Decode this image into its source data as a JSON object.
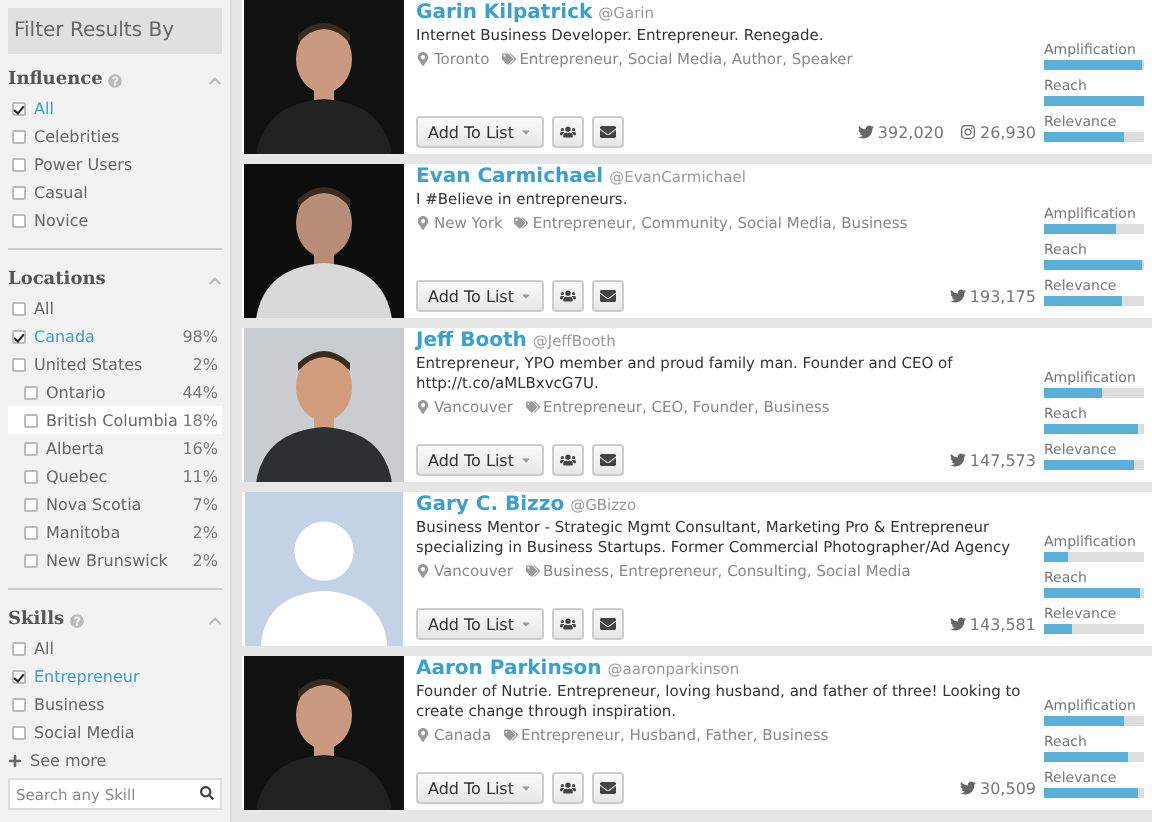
{
  "sidebar": {
    "title": "Filter Results By",
    "sections": [
      {
        "title": "Influence",
        "info_icon": true,
        "items": [
          {
            "label": "All",
            "checked": true,
            "highlighted": false
          },
          {
            "label": "Celebrities",
            "checked": false,
            "highlighted": false
          },
          {
            "label": "Power Users",
            "checked": false,
            "highlighted": false
          },
          {
            "label": "Casual",
            "checked": false,
            "highlighted": false
          },
          {
            "label": "Novice",
            "checked": false,
            "highlighted": false
          }
        ]
      },
      {
        "title": "Locations",
        "info_icon": false,
        "items": [
          {
            "label": "All",
            "checked": false,
            "highlighted": false
          },
          {
            "label": "Canada",
            "share": "98%",
            "checked": true,
            "highlighted": false
          },
          {
            "label": "United States",
            "share": "2%",
            "checked": false,
            "highlighted": false,
            "children": [
              {
                "label": "Ontario",
                "share": "44%",
                "checked": false,
                "highlighted": false
              },
              {
                "label": "British Columbia",
                "share": "18%",
                "checked": false,
                "highlighted": true
              },
              {
                "label": "Alberta",
                "share": "16%",
                "checked": false,
                "highlighted": false
              },
              {
                "label": "Quebec",
                "share": "11%",
                "checked": false,
                "highlighted": false
              },
              {
                "label": "Nova Scotia",
                "share": "7%",
                "checked": false,
                "highlighted": false
              },
              {
                "label": "Manitoba",
                "share": "2%",
                "checked": false,
                "highlighted": false
              },
              {
                "label": "New Brunswick",
                "share": "2%",
                "checked": false,
                "highlighted": false
              }
            ]
          }
        ]
      },
      {
        "title": "Skills",
        "info_icon": true,
        "items": [
          {
            "label": "All",
            "checked": false,
            "highlighted": false
          },
          {
            "label": "Entrepreneur",
            "checked": true,
            "highlighted": false
          },
          {
            "label": "Business",
            "checked": false,
            "highlighted": false
          },
          {
            "label": "Social Media",
            "checked": false,
            "highlighted": false
          }
        ],
        "see_more": "See more",
        "search": {
          "placeholder": "Search any Skill"
        }
      }
    ]
  },
  "results": [
    {
      "has_photo": true,
      "name": "Garin Kilpatrick",
      "handle": "@Garin",
      "bio": "Internet Business Developer. Entrepreneur. Renegade.",
      "location": "Toronto",
      "tags": "Entrepreneur, Social Media, Author, Speaker",
      "button": "Add To List",
      "stats": [
        {
          "kind": "twitter",
          "value": "392,020"
        },
        {
          "kind": "instagram",
          "value": "26,930"
        }
      ],
      "scores": [
        {
          "label": "Amplification",
          "level": 0.98
        },
        {
          "label": "Reach",
          "level": 0.99
        },
        {
          "label": "Relevance",
          "level": 0.8
        }
      ]
    },
    {
      "has_photo": true,
      "name": "Evan Carmichael",
      "handle": "@EvanCarmichael",
      "bio": "I #Believe in entrepreneurs.",
      "location": "New York",
      "tags": "Entrepreneur, Community, Social Media, Business",
      "button": "Add To List",
      "stats": [
        {
          "kind": "twitter",
          "value": "193,175"
        }
      ],
      "scores": [
        {
          "label": "Amplification",
          "level": 0.72
        },
        {
          "label": "Reach",
          "level": 0.98
        },
        {
          "label": "Relevance",
          "level": 0.78
        }
      ]
    },
    {
      "has_photo": true,
      "name": "Jeff Booth",
      "handle": "@JeffBooth",
      "bio": "Entrepreneur, YPO member and proud family man. Founder and CEO of http://t.co/aMLBxvcG7U.",
      "location": "Vancouver",
      "tags": "Entrepreneur, CEO, Founder, Business",
      "button": "Add To List",
      "stats": [
        {
          "kind": "twitter",
          "value": "147,573"
        }
      ],
      "scores": [
        {
          "label": "Amplification",
          "level": 0.58
        },
        {
          "label": "Reach",
          "level": 0.93
        },
        {
          "label": "Relevance",
          "level": 0.9
        }
      ]
    },
    {
      "has_photo": false,
      "name": "Gary C. Bizzo",
      "handle": "@GBizzo",
      "bio": "Business Mentor - Strategic Mgmt Consultant, Marketing Pro & Entrepreneur specializing in Business Startups. Former Commercial Photographer/Ad Agency",
      "location": "Vancouver",
      "tags": "Business, Entrepreneur, Consulting, Social Media",
      "button": "Add To List",
      "stats": [
        {
          "kind": "twitter",
          "value": "143,581"
        }
      ],
      "scores": [
        {
          "label": "Amplification",
          "level": 0.24
        },
        {
          "label": "Reach",
          "level": 0.96
        },
        {
          "label": "Relevance",
          "level": 0.27
        }
      ]
    },
    {
      "has_photo": true,
      "name": "Aaron Parkinson",
      "handle": "@aaronparkinson",
      "bio": "Founder of Nutrie. Entrepreneur, loving husband, and father of three! Looking to create change through inspiration.",
      "location": "Canada",
      "tags": "Entrepreneur, Husband, Father, Business",
      "button": "Add To List",
      "stats": [
        {
          "kind": "twitter",
          "value": "30,509"
        }
      ],
      "scores": [
        {
          "label": "Amplification",
          "level": 0.79
        },
        {
          "label": "Reach",
          "level": 0.83
        },
        {
          "label": "Relevance",
          "level": 0.94
        }
      ]
    }
  ]
}
